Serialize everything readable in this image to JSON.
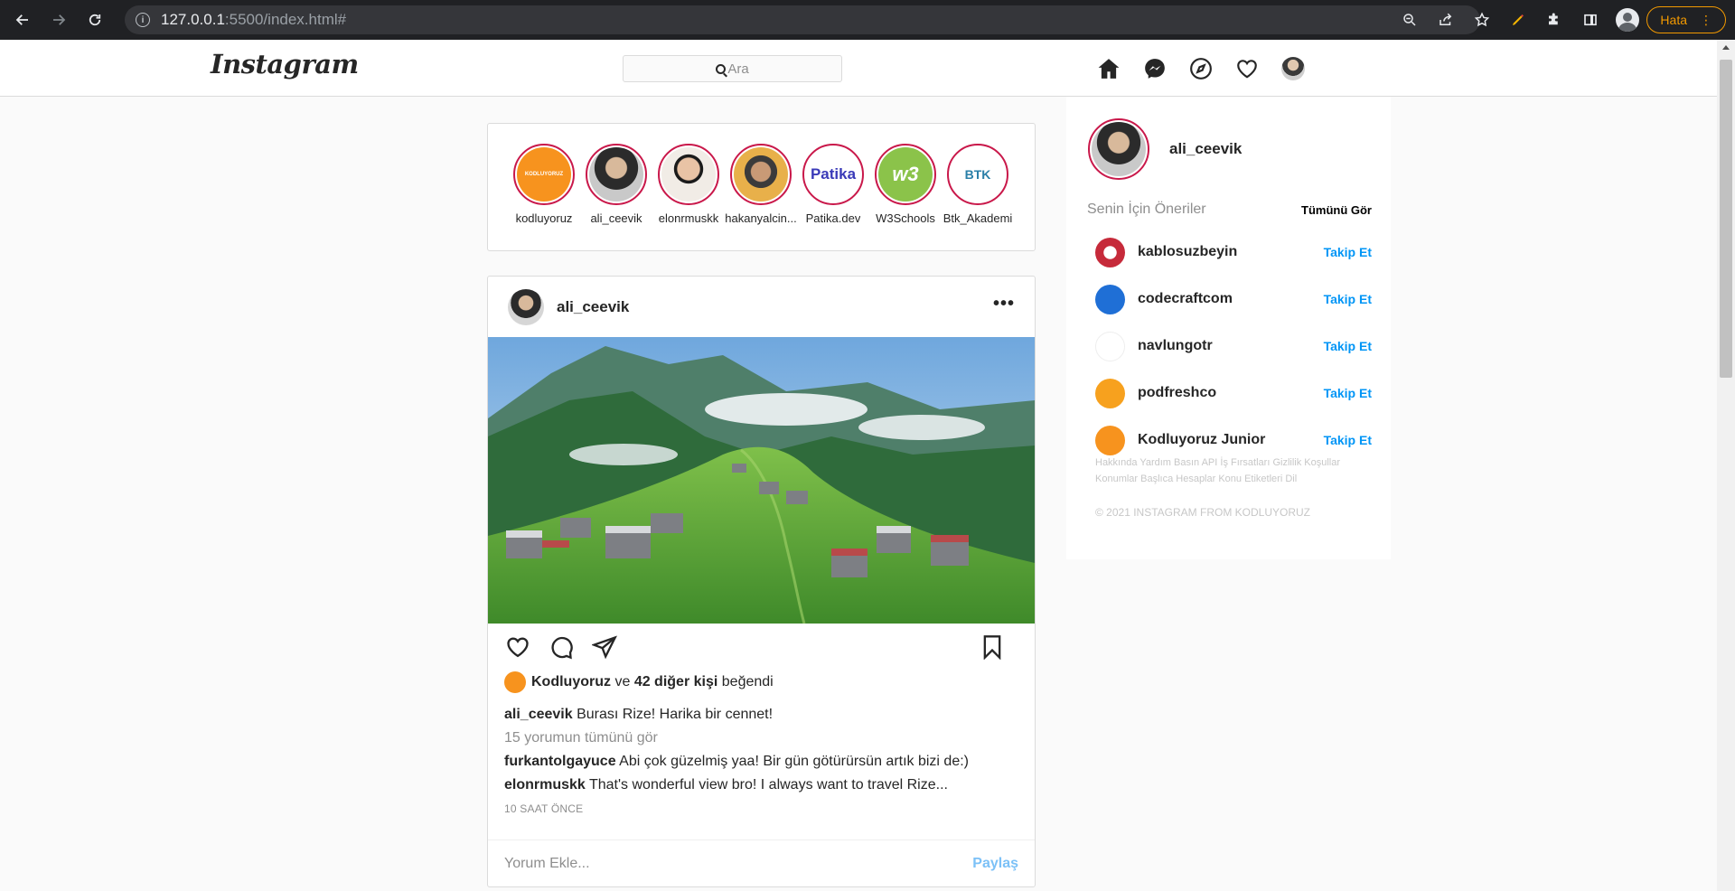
{
  "browser": {
    "url_host": "127.0.0.1",
    "url_rest": ":5500/index.html#",
    "error_label": "Hata"
  },
  "header": {
    "logo": "Instagram",
    "search_placeholder": "Ara"
  },
  "stories": [
    {
      "name": "kodluyoruz",
      "color": "#f7931e"
    },
    {
      "name": "ali_ceevik",
      "color": "#c8c8c8"
    },
    {
      "name": "elonrmuskk",
      "color": "#d9cfc4"
    },
    {
      "name": "hakanyalcin...",
      "color": "#e8b04a"
    },
    {
      "name": "Patika.dev",
      "color": "#ffffff"
    },
    {
      "name": "W3Schools",
      "color": "#8bc34a"
    },
    {
      "name": "Btk_Akademi",
      "color": "#ffffff"
    }
  ],
  "story_logos": {
    "patika": "Patika",
    "w3": "w3",
    "btk": "BTK"
  },
  "post": {
    "username": "ali_ceevik",
    "likes_user": "Kodluyoruz",
    "likes_and": "ve",
    "likes_others": "42 diğer kişi",
    "likes_suffix": "beğendi",
    "caption_user": "ali_ceevik",
    "caption_text": "Burası Rize! Harika bir cennet!",
    "view_all": "15 yorumun tümünü gör",
    "comments": [
      {
        "user": "furkantolgayuce",
        "text": "Abi çok güzelmiş yaa! Bir gün götürürsün artık bizi de:)"
      },
      {
        "user": "elonrmuskk",
        "text": "That's wonderful view bro! I always want to travel Rize..."
      }
    ],
    "time": "10 SAAT ÖNCE",
    "comment_placeholder": "Yorum Ekle...",
    "share_label": "Paylaş"
  },
  "sidebar": {
    "username": "ali_ceevik",
    "suggest_title": "Senin İçin Öneriler",
    "see_all": "Tümünü Gör",
    "suggestions": [
      {
        "name": "kablosuzbeyin",
        "follow": "Takip Et",
        "color": "#c62a3a"
      },
      {
        "name": "codecraftcom",
        "follow": "Takip Et",
        "color": "#1f6fd6"
      },
      {
        "name": "navlungotr",
        "follow": "Takip Et",
        "color": "#ffffff"
      },
      {
        "name": "podfreshco",
        "follow": "Takip Et",
        "color": "#f7a11e"
      },
      {
        "name": "Kodluyoruz Junior",
        "follow": "Takip Et",
        "color": "#f7931e"
      }
    ],
    "footer_links": "Hakkında Yardım Basın API İş Fırsatları Gizlilik Koşullar Konumlar Başlıca Hesaplar Konu Etiketleri Dil",
    "copyright": "© 2021 INSTAGRAM FROM KODLUYORUZ"
  }
}
